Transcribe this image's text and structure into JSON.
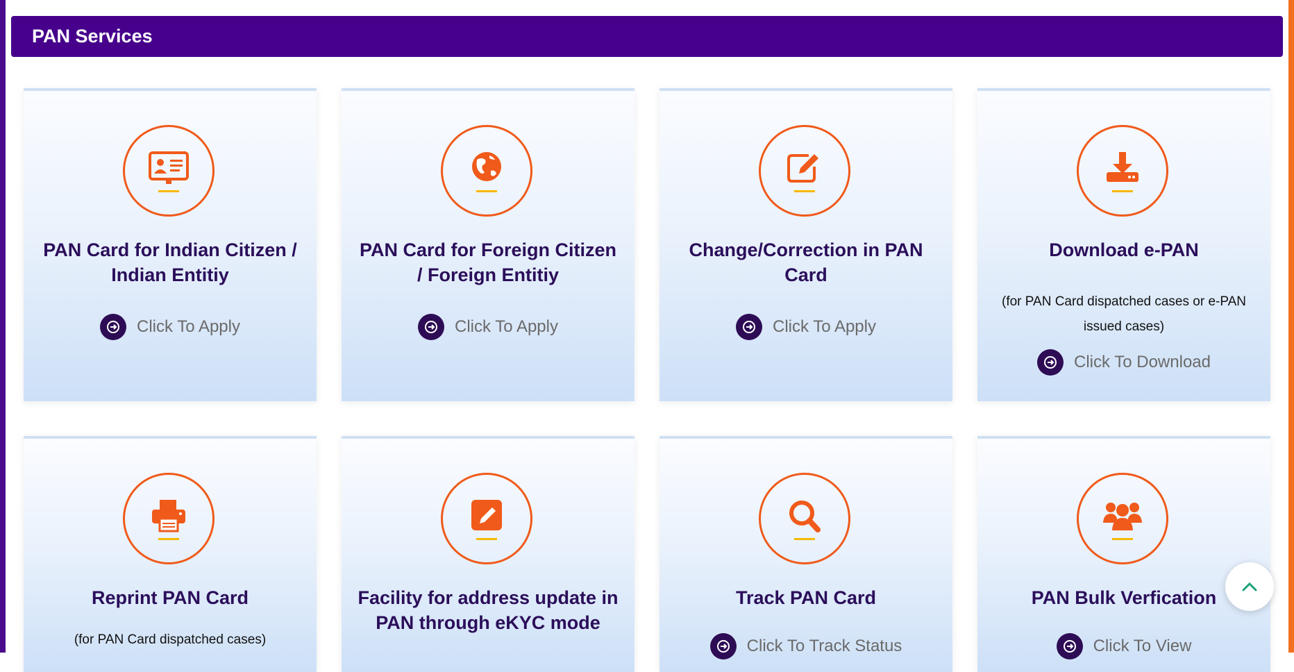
{
  "header": {
    "title": "PAN Services"
  },
  "cards": [
    {
      "icon": "id-card-icon",
      "title": "PAN Card for Indian Citizen / Indian Entitiy",
      "subtitle": "",
      "action": "Click To Apply"
    },
    {
      "icon": "globe-icon",
      "title": "PAN Card for Foreign Citizen / Foreign Entitiy",
      "subtitle": "",
      "action": "Click To Apply"
    },
    {
      "icon": "edit-icon",
      "title": "Change/Correction in PAN Card",
      "subtitle": "",
      "action": "Click To Apply"
    },
    {
      "icon": "download-icon",
      "title": "Download e-PAN",
      "subtitle": "(for PAN Card dispatched cases or e-PAN issued cases)",
      "action": "Click To Download"
    },
    {
      "icon": "printer-icon",
      "title": "Reprint PAN Card",
      "subtitle": "(for PAN Card dispatched cases)",
      "action": ""
    },
    {
      "icon": "pencil-square-icon",
      "title": "Facility for address update in PAN through eKYC mode",
      "subtitle": "",
      "action": ""
    },
    {
      "icon": "search-icon",
      "title": "Track PAN Card",
      "subtitle": "",
      "action": "Click To Track Status"
    },
    {
      "icon": "users-icon",
      "title": "PAN Bulk Verfication",
      "subtitle": "",
      "action": "Click To View"
    }
  ],
  "colors": {
    "header_bg": "#46008c",
    "accent_orange": "#f05a1a",
    "title_text": "#2b0e5a",
    "action_dot": "#2e0c55"
  }
}
